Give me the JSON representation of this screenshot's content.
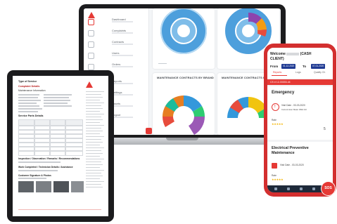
{
  "laptop": {
    "sidebar": {
      "items": [
        {
          "label": "Dashboard",
          "icon": "home-icon"
        },
        {
          "label": "Complaints",
          "icon": "list-icon"
        },
        {
          "label": "Contracts",
          "icon": "document-icon"
        },
        {
          "label": "Users",
          "icon": "user-icon"
        },
        {
          "label": "Orders",
          "icon": "cart-icon"
        },
        {
          "label": "Reports",
          "icon": "chart-icon"
        },
        {
          "label": "Settings",
          "icon": "gear-icon"
        },
        {
          "label": "Assets",
          "icon": "box-icon"
        },
        {
          "label": "Logout",
          "icon": "logout-icon"
        }
      ]
    },
    "cards": [
      {
        "title": "",
        "foot": ""
      },
      {
        "title": "",
        "foot": ""
      },
      {
        "title": "MAINTENANCE CONTRACTS BY BRAND",
        "foot": ""
      },
      {
        "title": "MAINTENANCE CONTRACTS BY TY",
        "foot": ""
      }
    ]
  },
  "tablet": {
    "doc_title": "Type of Service",
    "section1": "Complaint Details",
    "section2": "Maintenance Information",
    "table_header": "Service Parts Details",
    "section3": "Inspection / Observation / Remarks / Recommendations",
    "section4": "Work Completed / Technician Details / Assistance",
    "section5": "Customer Signature & Photos"
  },
  "phone": {
    "welcome": "Welcome",
    "client": "CLIENT)",
    "client_suffix": "(CASH",
    "from_label": "From",
    "to_label": "To",
    "from_date": "01-12-2020",
    "to_date": "07-01-2020",
    "tabs": [
      "Reports",
      "Logs",
      "Quality Ch"
    ],
    "bar_text": "CS # 12-33333-44",
    "card1": {
      "title": "Emergency",
      "visit_date": "Visit Date - 03-03-2020",
      "status": "Current Hour Meter   OMA Vol",
      "rate_label": "Rate",
      "stars": "★★★★★",
      "count": "5"
    },
    "card2": {
      "title_line1": "Electrical Preventive",
      "title_line2": "Maintenance",
      "visit_date": "Visit Date - 03-03-2020",
      "rate_label": "Rate",
      "stars": "★★★★★"
    },
    "sos_label": "SOS"
  }
}
